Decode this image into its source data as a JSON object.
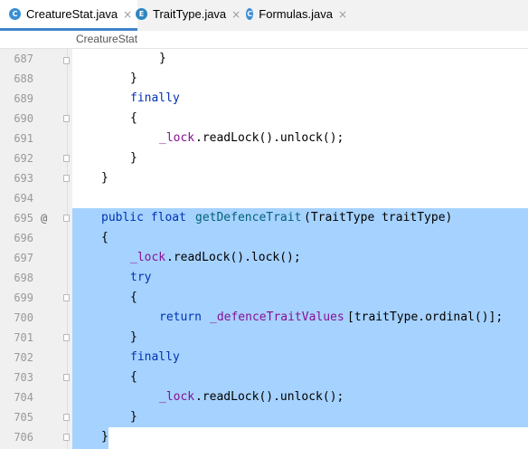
{
  "tabs": [
    {
      "icon": "C",
      "icon_name": "class-icon",
      "label": "CreatureStat.java",
      "active": true
    },
    {
      "icon": "E",
      "icon_name": "enum-icon",
      "label": "TraitType.java",
      "active": false
    },
    {
      "icon": "C",
      "icon_name": "class-icon",
      "label": "Formulas.java",
      "active": false
    }
  ],
  "close_glyph": "×",
  "breadcrumb": "CreatureStat",
  "gutter_annotation": "@",
  "colors": {
    "keyword": "#0033b3",
    "field": "#871094",
    "method": "#00627a",
    "selection": "#a6d2ff",
    "tab_underline": "#4083c9",
    "class_icon": "#3a8fd6",
    "enum_icon": "#2e86c1"
  },
  "lines": [
    {
      "n": "687",
      "c": "}"
    },
    {
      "n": "688",
      "c": "}"
    },
    {
      "n": "689",
      "c": "finally"
    },
    {
      "n": "690",
      "c": "{"
    },
    {
      "n": "691",
      "c": "_lock",
      "c2": ".readLock().unlock();"
    },
    {
      "n": "692",
      "c": "}"
    },
    {
      "n": "693",
      "c": "}"
    },
    {
      "n": "694",
      "c": ""
    },
    {
      "n": "695",
      "kw": "public float ",
      "fn": "getDefenceTrait",
      "rest": "(TraitType traitType)"
    },
    {
      "n": "696",
      "c": "{"
    },
    {
      "n": "697",
      "c": "_lock",
      "c2": ".readLock().lock();"
    },
    {
      "n": "698",
      "c": "try"
    },
    {
      "n": "699",
      "c": "{"
    },
    {
      "n": "700",
      "kw": "return ",
      "fld": "_defenceTraitValues",
      "rest": "[traitType.ordinal()];"
    },
    {
      "n": "701",
      "c": "}"
    },
    {
      "n": "702",
      "c": "finally"
    },
    {
      "n": "703",
      "c": "{"
    },
    {
      "n": "704",
      "c": "_lock",
      "c2": ".readLock().unlock();"
    },
    {
      "n": "705",
      "c": "}"
    },
    {
      "n": "706",
      "c": "}"
    }
  ]
}
